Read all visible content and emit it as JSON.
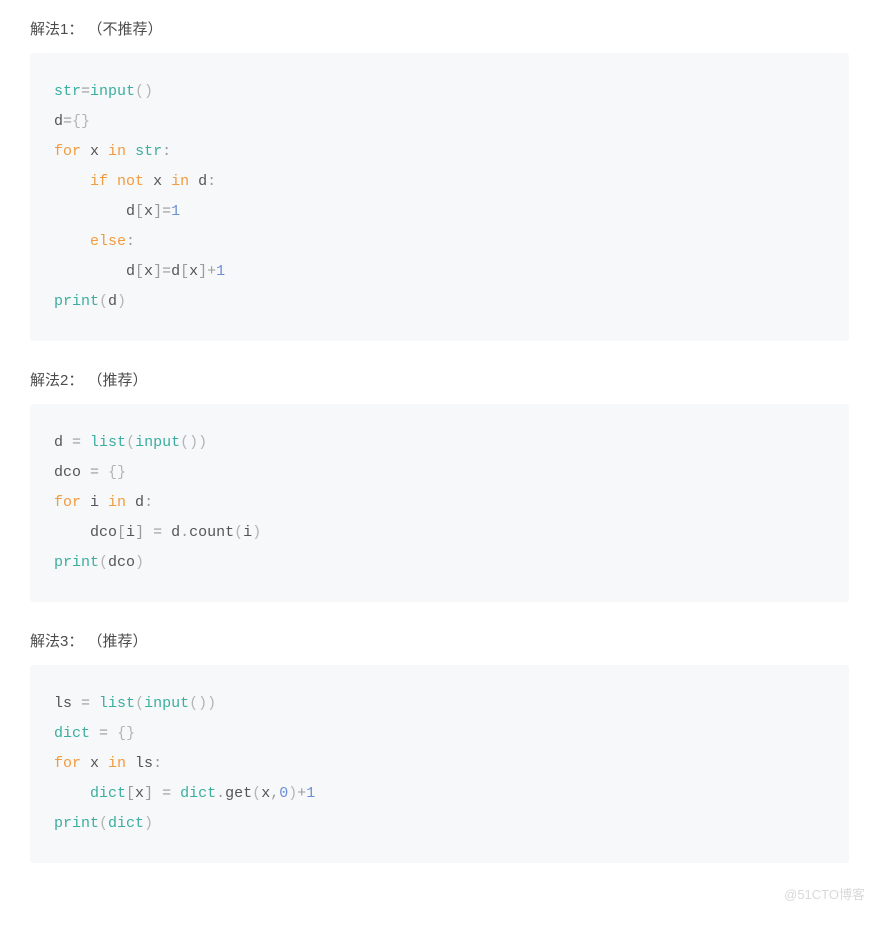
{
  "sections": [
    {
      "label": "解法1： （不推荐）"
    },
    {
      "label": "解法2： （推荐）"
    },
    {
      "label": "解法3： （推荐）"
    }
  ],
  "code1": {
    "l1": {
      "a": "str",
      "b": "=",
      "c": "input",
      "d": "()"
    },
    "l2": {
      "a": "d",
      "b": "=",
      "c": "{}"
    },
    "l3": {
      "a": "for",
      "b": " x ",
      "c": "in",
      "d": " ",
      "e": "str",
      "f": ":"
    },
    "l4": {
      "a": "if",
      "b": " ",
      "c": "not",
      "d": " x ",
      "e": "in",
      "f": " d",
      "g": ":"
    },
    "l5": {
      "a": "d",
      "b": "[",
      "c": "x",
      "d": "]",
      "e": "=",
      "f": "1"
    },
    "l6": {
      "a": "else",
      "b": ":"
    },
    "l7": {
      "a": "d",
      "b": "[",
      "c": "x",
      "d": "]",
      "e": "=",
      "f": "d",
      "g": "[",
      "h": "x",
      "i": "]",
      "j": "+",
      "k": "1"
    },
    "l8": {
      "a": "print",
      "b": "(",
      "c": "d",
      "d": ")"
    }
  },
  "code2": {
    "l1": {
      "a": "d ",
      "b": "=",
      "c": " ",
      "d": "list",
      "e": "(",
      "f": "input",
      "g": "())"
    },
    "l2": {
      "a": "dco ",
      "b": "=",
      "c": " ",
      "d": "{}"
    },
    "l3": {
      "a": "for",
      "b": " i ",
      "c": "in",
      "d": " d",
      "e": ":"
    },
    "l4": {
      "a": "dco",
      "b": "[",
      "c": "i",
      "d": "]",
      "e": " ",
      "f": "=",
      "g": " d",
      "h": ".",
      "i": "count",
      "j": "(",
      "k": "i",
      "l": ")"
    },
    "l5": {
      "a": "print",
      "b": "(",
      "c": "dco",
      "d": ")"
    }
  },
  "code3": {
    "l1": {
      "a": "ls ",
      "b": "=",
      "c": " ",
      "d": "list",
      "e": "(",
      "f": "input",
      "g": "())"
    },
    "l2": {
      "a": "dict",
      "b": " ",
      "c": "=",
      "d": " ",
      "e": "{}"
    },
    "l3": {
      "a": "for",
      "b": " x ",
      "c": "in",
      "d": " ls",
      "e": ":"
    },
    "l4": {
      "a": "dict",
      "b": "[",
      "c": "x",
      "d": "]",
      "e": " ",
      "f": "=",
      "g": " ",
      "h": "dict",
      "i": ".",
      "j": "get",
      "k": "(",
      "l": "x",
      "m": ",",
      "n": "0",
      "o": ")",
      "p": "+",
      "q": "1"
    },
    "l5": {
      "a": "print",
      "b": "(",
      "c": "dict",
      "d": ")"
    }
  },
  "watermark": "@51CTO博客"
}
